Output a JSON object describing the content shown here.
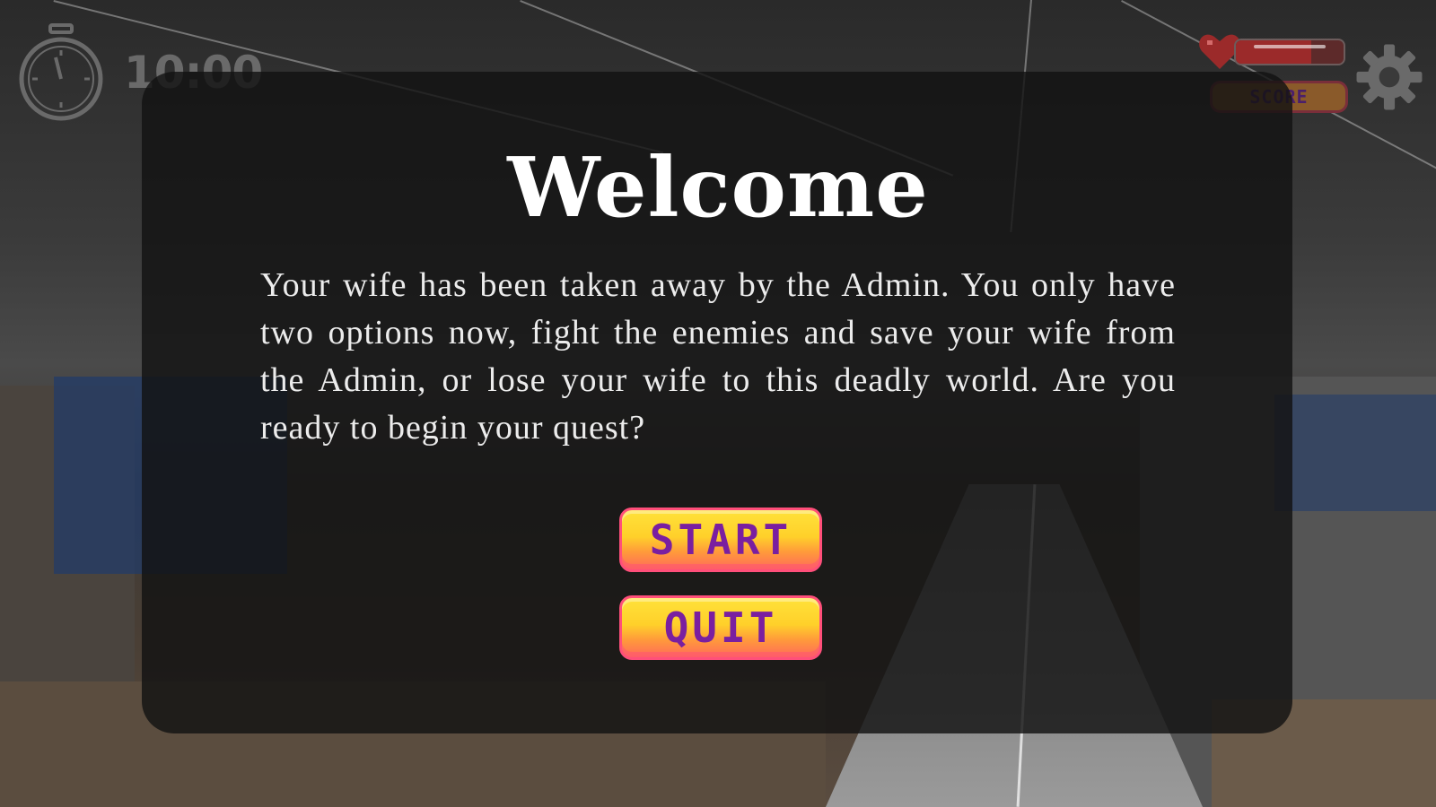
{
  "hud": {
    "timer": "10:00",
    "score_label": "SCORE",
    "health_fraction": 0.7
  },
  "dialog": {
    "title": "Welcome",
    "message": "Your wife has been taken away by the Admin. You only have two options now, fight the enemies and save your wife from the Admin, or lose your wife to this deadly world. Are you ready to begin your quest?",
    "start_label": "START",
    "quit_label": "QUIT"
  },
  "icons": {
    "timer": "stopwatch-icon",
    "health": "heart-icon",
    "settings": "gear-icon"
  },
  "colors": {
    "button_text": "#7a1fa0",
    "button_fill": "#ffd02a",
    "button_border": "#ff4f7a",
    "panel": "#121212"
  }
}
